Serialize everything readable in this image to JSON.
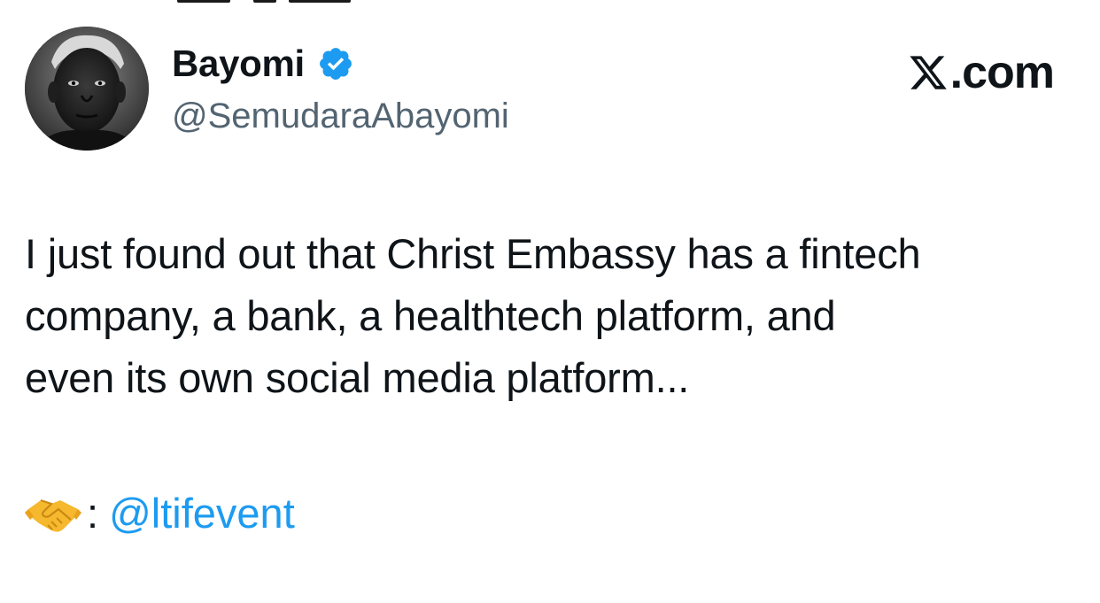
{
  "author": {
    "display_name": "Bayomi",
    "handle": "@SemudaraAbayomi",
    "verified": true,
    "verified_color": "#1d9bf0",
    "avatar_icon": "profile-photo"
  },
  "brand": {
    "logo_icon": "x-logo-icon",
    "label": ".com"
  },
  "tweet": {
    "lines": [
      "I just found out that Christ Embassy has a fintech",
      "company, a bank, a healthtech platform, and",
      "even its own social media platform..."
    ]
  },
  "credit": {
    "emoji_icon": "handshake-icon",
    "separator": ":",
    "mention": "@ltifevent"
  },
  "colors": {
    "text": "#0f1419",
    "secondary": "#536471",
    "link": "#1d9bf0",
    "background": "#ffffff"
  }
}
